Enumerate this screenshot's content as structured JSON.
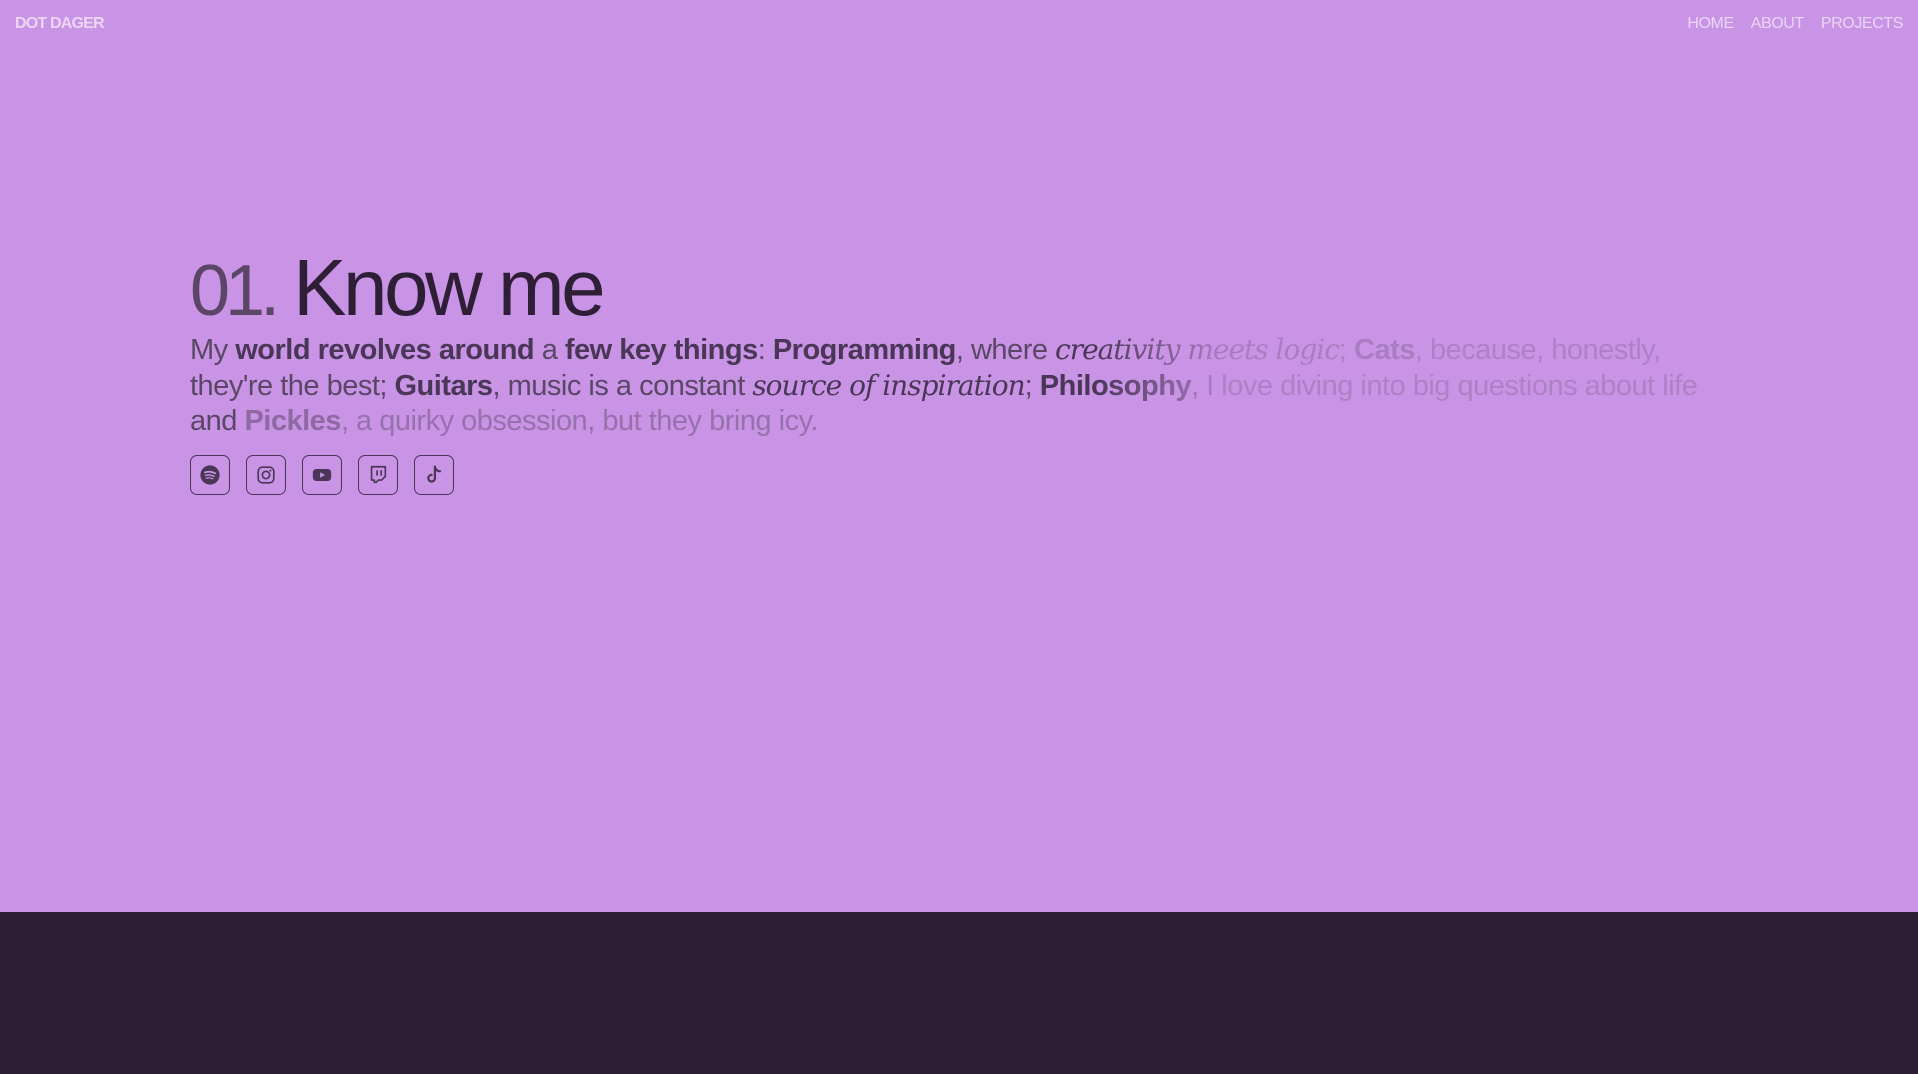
{
  "brand": {
    "logo": "DOT DAGER"
  },
  "nav": {
    "items": [
      "HOME",
      "ABOUT",
      "PROJECTS"
    ]
  },
  "section": {
    "number": "01.",
    "title": "Know me",
    "intro": {
      "t1": "My ",
      "b1": "world revolves around",
      "t2": " a ",
      "b2": "few key things",
      "t3": ": ",
      "b3": "Programming",
      "t4": ", where ",
      "i1": "creativity meets logic",
      "t5": "; ",
      "b4": "Cats",
      "t6": ", because, honestly, they're the best; ",
      "b5": "Guitars",
      "t7": ", music is a constant ",
      "i2": "source of inspiration",
      "t8": "; ",
      "b6": "Philosophy",
      "t9": ", I love diving into big questions about life and ",
      "b7": "Pickles",
      "t10": ", a quirky obsession, but they bring icy."
    }
  },
  "socials": [
    {
      "name": "spotify-icon"
    },
    {
      "name": "instagram-icon"
    },
    {
      "name": "youtube-icon"
    },
    {
      "name": "twitch-icon"
    },
    {
      "name": "tiktok-icon"
    }
  ],
  "colors": {
    "background": "#c994e6",
    "footer": "#2e1f36",
    "text_dark": "#2e1f36",
    "text_muted": "#5a4766",
    "nav_text": "#ebd6f5"
  }
}
